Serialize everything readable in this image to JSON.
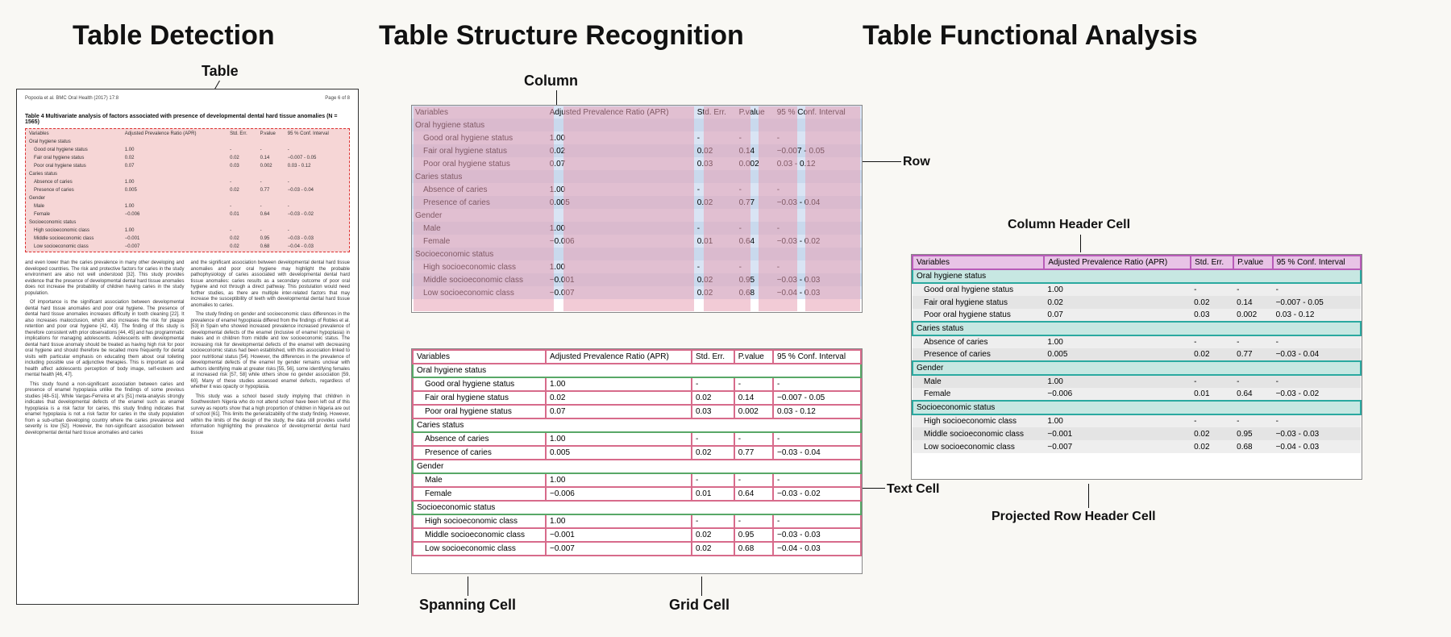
{
  "headings": {
    "h1": "Table Detection",
    "h2": "Table Structure Recognition",
    "h3": "Table Functional Analysis"
  },
  "labels": {
    "table": "Table",
    "column": "Column",
    "row": "Row",
    "spanning_cell": "Spanning Cell",
    "grid_cell": "Grid Cell",
    "text_cell": "Text Cell",
    "column_header_cell": "Column Header Cell",
    "projected_row_header": "Projected Row Header Cell"
  },
  "doc": {
    "journal": "Popoola et al. BMC Oral Health  (2017) 17:8",
    "page": "Page 6 of 8",
    "tbl_caption": "Table 4 Multivariate analysis of factors associated with presence of developmental dental hard tissue anomalies (N = 1565)",
    "para1a": "and even lower than the caries prevalence in many other developing and developed countries. The risk and protective factors for caries in the study environment are also not well understood [32]. This study provides evidence that the presence of developmental dental hard tissue anomalies does not increase the probability of children having caries in the study population.",
    "para1b": "Of importance is the significant association between developmental dental hard tissue anomalies and poor oral hygiene. The presence of dental hard tissue anomalies increases difficulty in tooth cleaning [22]. It also increases malocclusion, which also increases the risk for plaque retention and poor oral hygiene [42, 43]. The finding of this study is therefore consistent with prior observations [44, 45] and has programmatic implications for managing adolescents. Adolescents with developmental dental hard tissue anomaly should be treated as having high risk for poor oral hygiene and should therefore be recalled more frequently for dental visits with particular emphasis on educating them about oral toileting including possible use of adjunctive therapies. This is important as oral health affect adolescents perception of body image, self-esteem and mental health [46, 47].",
    "para1c": "This study found a non-significant association between caries and presence of enamel hypoplasia unlike the findings of some previous studies [48–51]. While Vargas-Ferreira et al's [51] meta-analysis strongly indicates that developmental defects of the enamel such as enamel hypoplasia is a risk factor for caries, this study finding indicates that enamel hypoplasia is not a risk factor for caries in the study population from a sub-urban developing country where the caries prevalence and severity is low [52]. However, the non-significant association between developmental dental hard tissue anomalies and caries",
    "para2a": "and the significant association between developmental dental hard tissue anomalies and poor oral hygiene may highlight the probable pathophysiology of caries associated with developmental dental hard tissue anomalies: caries results as a secondary outcome of poor oral hygiene and not through a direct pathway. This postulation would need further studies, as there are multiple inter-related factors that may increase the susceptibility of teeth with developmental dental hard tissue anomalies to caries.",
    "para2b": "The study finding on gender and socioeconomic class differences in the prevalence of enamel hypoplasia differed from the findings of Robles et al. [53] in Spain who showed increased prevalence increased prevalence of developmental defects of the enamel (inclusive of enamel hypoplasia) in males and in children from middle and low socioeconomic status. The increasing risk for developmental defects of the enamel with decreasing socioeconomic status had been established, with this association linked to poor nutritional status [54]. However, the differences in the prevalence of developmental defects of the enamel by gender remains unclear with authors identifying male at greater risks [55, 56], some identifying females at increased risk [57, 58] while others show no gender association [59, 60]. Many of these studies assessed enamel defects, regardless of whether it was opacity or hypoplasia.",
    "para2c": "This study was a school based study implying that children in Southwestern Nigeria who do not attend school have been left out of this survey as reports show that a high proportion of children in Nigeria are out of school [61]. This limits the generalizability of the study finding. However, within the limits of the design of the study, the data still provides useful information highlighting the prevalence of developmental dental hard tissue"
  },
  "table": {
    "cols": [
      "Variables",
      "Adjusted Prevalence Ratio (APR)",
      "Std. Err.",
      "P.value",
      "95 % Conf. Interval"
    ],
    "sections": [
      {
        "name": "Oral hygiene status",
        "rows": [
          {
            "c0": "Good oral hygiene status",
            "c1": "1.00",
            "c2": "-",
            "c3": "-",
            "c4": "-"
          },
          {
            "c0": "Fair oral hygiene status",
            "c1": "0.02",
            "c2": "0.02",
            "c3": "0.14",
            "c4": "−0.007 - 0.05"
          },
          {
            "c0": "Poor oral hygiene status",
            "c1": "0.07",
            "c2": "0.03",
            "c3": "0.002",
            "c4": "0.03 - 0.12"
          }
        ]
      },
      {
        "name": "Caries status",
        "rows": [
          {
            "c0": "Absence of caries",
            "c1": "1.00",
            "c2": "-",
            "c3": "-",
            "c4": "-"
          },
          {
            "c0": "Presence of caries",
            "c1": "0.005",
            "c2": "0.02",
            "c3": "0.77",
            "c4": "−0.03 - 0.04"
          }
        ]
      },
      {
        "name": "Gender",
        "rows": [
          {
            "c0": "Male",
            "c1": "1.00",
            "c2": "-",
            "c3": "-",
            "c4": "-"
          },
          {
            "c0": "Female",
            "c1": "−0.006",
            "c2": "0.01",
            "c3": "0.64",
            "c4": "−0.03 - 0.02"
          }
        ]
      },
      {
        "name": "Socioeconomic status",
        "rows": [
          {
            "c0": "High socioeconomic class",
            "c1": "1.00",
            "c2": "-",
            "c3": "-",
            "c4": "-"
          },
          {
            "c0": "Middle socioeconomic class",
            "c1": "−0.001",
            "c2": "0.02",
            "c3": "0.95",
            "c4": "−0.03 - 0.03"
          },
          {
            "c0": "Low socioeconomic class",
            "c1": "−0.007",
            "c2": "0.02",
            "c3": "0.68",
            "c4": "−0.04 - 0.03"
          }
        ]
      }
    ]
  },
  "chart_data": {
    "type": "table",
    "title": "Table 4 Multivariate analysis of factors associated with presence of developmental dental hard tissue anomalies (N = 1565)",
    "columns": [
      "Variables",
      "Adjusted Prevalence Ratio (APR)",
      "Std. Err.",
      "P.value",
      "95 % Conf. Interval"
    ],
    "rows": [
      [
        "Oral hygiene status",
        "",
        "",
        "",
        ""
      ],
      [
        "Good oral hygiene status",
        "1.00",
        "-",
        "-",
        "-"
      ],
      [
        "Fair oral hygiene status",
        "0.02",
        "0.02",
        "0.14",
        "−0.007 - 0.05"
      ],
      [
        "Poor oral hygiene status",
        "0.07",
        "0.03",
        "0.002",
        "0.03 - 0.12"
      ],
      [
        "Caries status",
        "",
        "",
        "",
        ""
      ],
      [
        "Absence of caries",
        "1.00",
        "-",
        "-",
        "-"
      ],
      [
        "Presence of caries",
        "0.005",
        "0.02",
        "0.77",
        "−0.03 - 0.04"
      ],
      [
        "Gender",
        "",
        "",
        "",
        ""
      ],
      [
        "Male",
        "1.00",
        "-",
        "-",
        "-"
      ],
      [
        "Female",
        "−0.006",
        "0.01",
        "0.64",
        "−0.03 - 0.02"
      ],
      [
        "Socioeconomic status",
        "",
        "",
        "",
        ""
      ],
      [
        "High socioeconomic class",
        "1.00",
        "-",
        "-",
        "-"
      ],
      [
        "Middle socioeconomic class",
        "−0.001",
        "0.02",
        "0.95",
        "−0.03 - 0.03"
      ],
      [
        "Low socioeconomic class",
        "−0.007",
        "0.02",
        "0.68",
        "−0.04 - 0.03"
      ]
    ]
  }
}
